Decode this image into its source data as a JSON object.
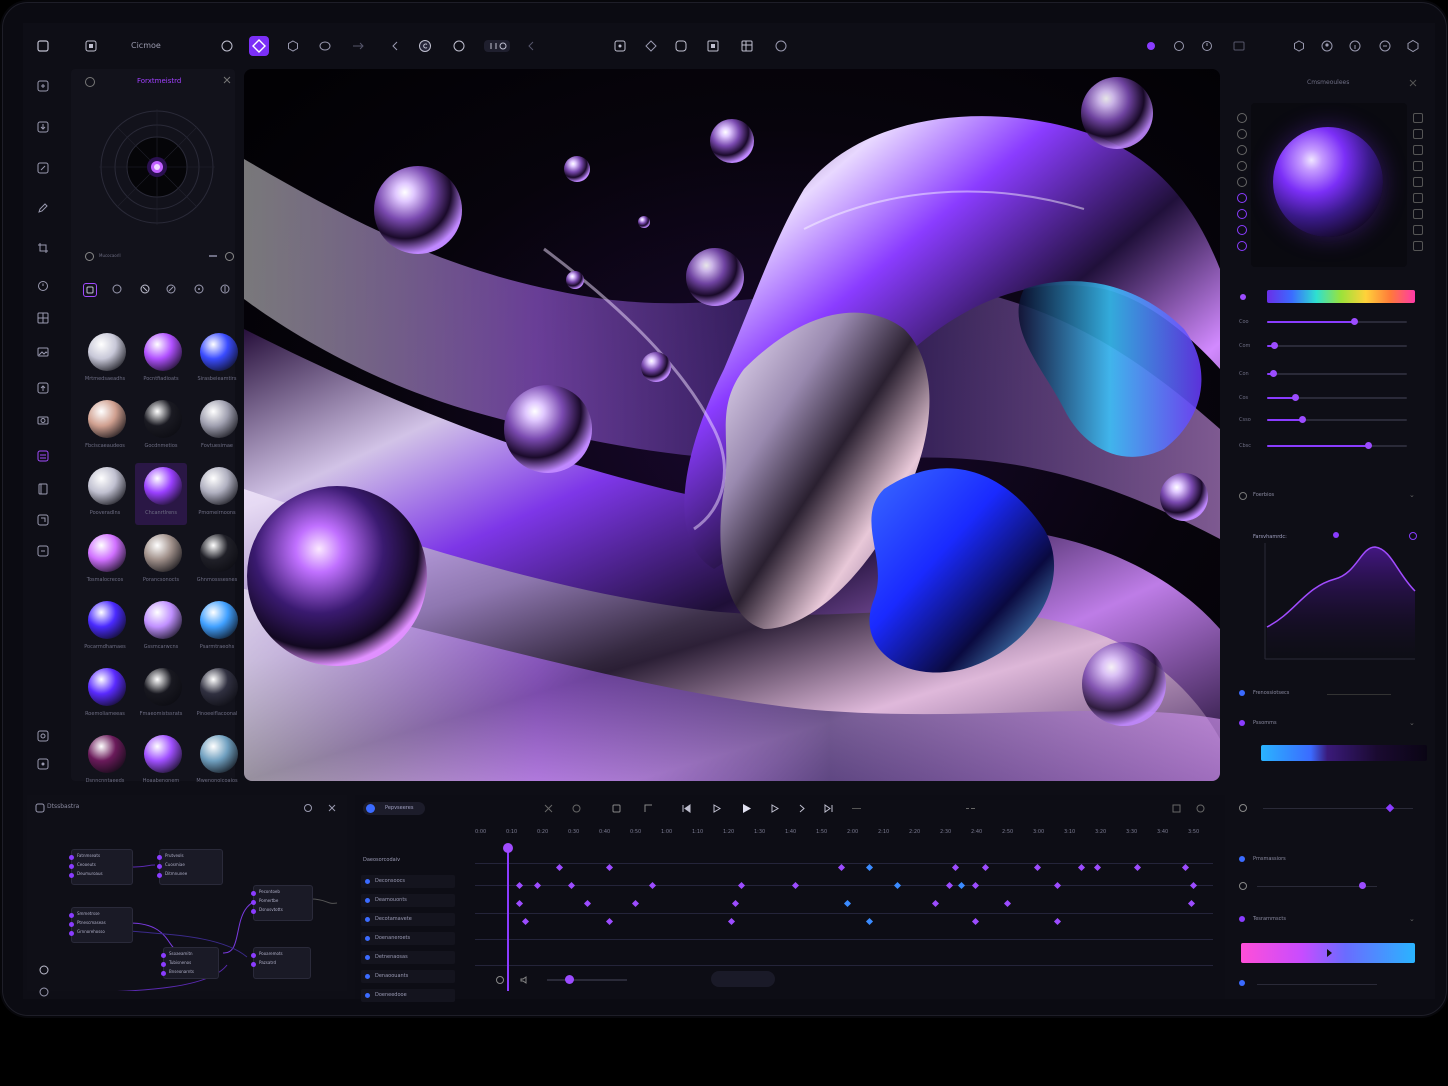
{
  "app": {
    "doc_title": "Cicmoe"
  },
  "left_panel": {
    "title": "Forxtmeistrd",
    "row_label": "Mucocaorll",
    "materials": [
      {
        "label": "Mrtmedsaeadhs",
        "color": "#c8c8d8"
      },
      {
        "label": "Pocntfiadioats",
        "color": "#b050ff"
      },
      {
        "label": "Sirasbeieamtirs",
        "color": "#3a4cff"
      },
      {
        "label": "Fbciscaeaudeos",
        "color": "#d0a090"
      },
      {
        "label": "Gocdnmetios",
        "color": "#1a1a22"
      },
      {
        "label": "Fovtuesimae",
        "color": "#a0a0b0"
      },
      {
        "label": "Pooveradlns",
        "color": "#c0c0d0"
      },
      {
        "label": "Chcanrtlrens",
        "color": "#9a40ff"
      },
      {
        "label": "Pmomeirnoons",
        "color": "#b0b0c0"
      },
      {
        "label": "Tosmalocrecos",
        "color": "#d070ff"
      },
      {
        "label": "Porancsonocts",
        "color": "#a0908a"
      },
      {
        "label": "Ghnmosssesnes",
        "color": "#202028"
      },
      {
        "label": "Pocarmdhamaes",
        "color": "#4a2aff"
      },
      {
        "label": "Gssmcarwcns",
        "color": "#c090ff"
      },
      {
        "label": "Psarmtraeohs",
        "color": "#40a0ff"
      },
      {
        "label": "Roemoliameeas",
        "color": "#5a2aff"
      },
      {
        "label": "Fmaeomistssrats",
        "color": "#181820"
      },
      {
        "label": "Pinoeeiflacoonal",
        "color": "#303040"
      },
      {
        "label": "Dsnncnntaeeds",
        "color": "#6a1a5a"
      },
      {
        "label": "Hoaabenonem",
        "color": "#a050ff"
      },
      {
        "label": "Mwenonoicoaios",
        "color": "#70a0c0"
      }
    ]
  },
  "right_panel": {
    "title": "Cmsmeoulees",
    "rows": [
      {
        "label": "Coo",
        "value": 0.62
      },
      {
        "label": "Com",
        "value": 0.05
      },
      {
        "label": "Con",
        "value": 0.04
      },
      {
        "label": "Cos",
        "value": 0.2
      },
      {
        "label": "Csso",
        "value": 0.25
      },
      {
        "label": "Cbsc",
        "value": 0.72
      }
    ],
    "section1": "Foerbios",
    "curve_title": "Farsvhamrdc:",
    "section2": "Frenossiotsecs",
    "section3": "Pssomms",
    "section4": "Pmsmassiors",
    "section5": "Tesrarnmscts"
  },
  "node_panel": {
    "title": "Dtssbastra",
    "nodes": [
      {
        "rows": [
          "Fatnmseats",
          "Ceooeuts",
          "Deumuroaus"
        ]
      },
      {
        "rows": [
          "Prutveols",
          "Cuosmiae",
          "Ditmnunee"
        ]
      },
      {
        "rows": [
          "Smmetrsse",
          "Ptnescmaseas",
          "Grnnorehosso"
        ]
      },
      {
        "rows": [
          "Pecontoeb",
          "Pomertbe",
          "Dsnosvtotts"
        ]
      },
      {
        "rows": [
          "Ssoaeamitn",
          "Tubisnenos",
          "Bnseonarnts"
        ]
      },
      {
        "rows": [
          "Pooaremots",
          "Pazsatrd"
        ]
      }
    ]
  },
  "timeline": {
    "chip": "Pepvseeres",
    "list_header": "Daeosorcodaiv",
    "tracks": [
      "Deconsoocs",
      "Deamouonts",
      "Decotamavete",
      "Doenaneroets",
      "Detnenaosas",
      "Denaoouants",
      "Doeneedooe"
    ],
    "ruler": [
      "0:00",
      "0:10",
      "0:20",
      "0:30",
      "0:40",
      "0:50",
      "1:00",
      "1:10",
      "1:20",
      "1:30",
      "1:40",
      "1:50",
      "2:00",
      "2:10",
      "2:20",
      "2:30",
      "2:40",
      "2:50",
      "3:00",
      "3:10",
      "3:20",
      "3:30",
      "3:40",
      "3:50"
    ]
  },
  "colors": {
    "accent": "#7b2ff7",
    "accent_light": "#a14cff",
    "blue": "#3b6bff",
    "bg": "#0e0e16"
  }
}
